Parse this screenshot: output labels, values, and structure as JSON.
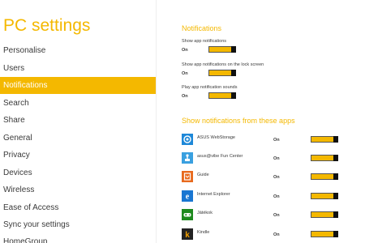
{
  "nav": {
    "title": "PC settings",
    "items": [
      {
        "label": "Personalise"
      },
      {
        "label": "Users"
      },
      {
        "label": "Notifications"
      },
      {
        "label": "Search"
      },
      {
        "label": "Share"
      },
      {
        "label": "General"
      },
      {
        "label": "Privacy"
      },
      {
        "label": "Devices"
      },
      {
        "label": "Wireless"
      },
      {
        "label": "Ease of Access"
      },
      {
        "label": "Sync your settings"
      },
      {
        "label": "HomeGroup"
      }
    ],
    "selected": "Notifications"
  },
  "notifications": {
    "title": "Notifications",
    "settings": [
      {
        "label": "Show app notifications",
        "state": "On",
        "on": true
      },
      {
        "label": "Show app notifications on the lock screen",
        "state": "On",
        "on": true
      },
      {
        "label": "Play app notification sounds",
        "state": "On",
        "on": true
      }
    ]
  },
  "apps_section": {
    "title": "Show notifications from these apps",
    "apps": [
      {
        "name": "ASUS WebStorage",
        "state": "On",
        "on": true,
        "icon": "cloud-icon",
        "color": "#1e88d8"
      },
      {
        "name": "asus@vibe Fun Center",
        "state": "On",
        "on": true,
        "icon": "joystick-icon",
        "color": "#3aa0e0"
      },
      {
        "name": "Guide",
        "state": "On",
        "on": true,
        "icon": "guide-icon",
        "color": "#e86a1e"
      },
      {
        "name": "Internet Explorer",
        "state": "On",
        "on": true,
        "icon": "ie-icon",
        "color": "#1976d2"
      },
      {
        "name": "Játékok",
        "state": "On",
        "on": true,
        "icon": "gamepad-icon",
        "color": "#1f8a1f"
      },
      {
        "name": "Kindle",
        "state": "On",
        "on": true,
        "icon": "kindle-icon",
        "color": "#222222"
      }
    ]
  },
  "colors": {
    "accent": "#f4b800",
    "text": "#3a3a3a",
    "background": "#ffffff"
  }
}
